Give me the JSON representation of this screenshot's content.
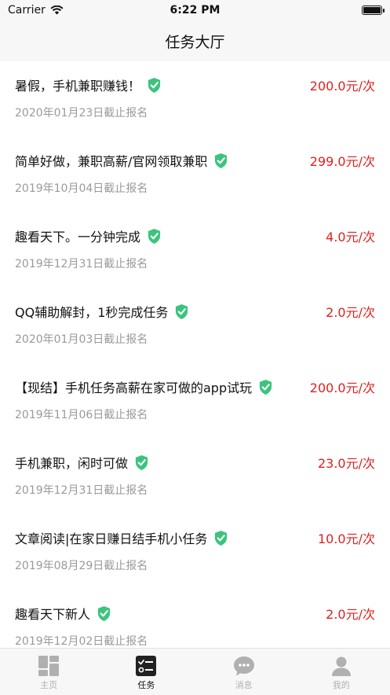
{
  "status_bar": {
    "carrier": "Carrier",
    "time": "6:22 PM"
  },
  "nav": {
    "title": "任务大厅"
  },
  "tasks": [
    {
      "title": "暑假，手机兼职赚钱！",
      "price": "200.0元/次",
      "deadline": "2020年01月23日截止报名"
    },
    {
      "title": "简单好做，兼职高薪/官网领取兼职",
      "price": "299.0元/次",
      "deadline": "2019年10月04日截止报名"
    },
    {
      "title": "趣看天下。一分钟完成",
      "price": "4.0元/次",
      "deadline": "2019年12月31日截止报名"
    },
    {
      "title": "QQ辅助解封，1秒完成任务",
      "price": "2.0元/次",
      "deadline": "2020年01月03日截止报名"
    },
    {
      "title": "【现结】手机任务高薪在家可做的app试玩",
      "price": "200.0元/次",
      "deadline": "2019年11月06日截止报名"
    },
    {
      "title": "手机兼职，闲时可做",
      "price": "23.0元/次",
      "deadline": "2019年12月31日截止报名"
    },
    {
      "title": "文章阅读|在家日赚日结手机小任务",
      "price": "10.0元/次",
      "deadline": "2019年08月29日截止报名"
    },
    {
      "title": "趣看天下新人",
      "price": "2.0元/次",
      "deadline": "2019年12月02日截止报名"
    }
  ],
  "tabs": [
    {
      "label": "主页",
      "icon": "home-grid-icon",
      "active": false
    },
    {
      "label": "任务",
      "icon": "task-list-icon",
      "active": true
    },
    {
      "label": "消息",
      "icon": "message-bubble-icon",
      "active": false
    },
    {
      "label": "我的",
      "icon": "profile-person-icon",
      "active": false
    }
  ],
  "colors": {
    "price": "#e0201e",
    "shield": "#3cc47e",
    "secondary_text": "#9a9a9a",
    "inactive_tab": "#b0b0b0"
  }
}
